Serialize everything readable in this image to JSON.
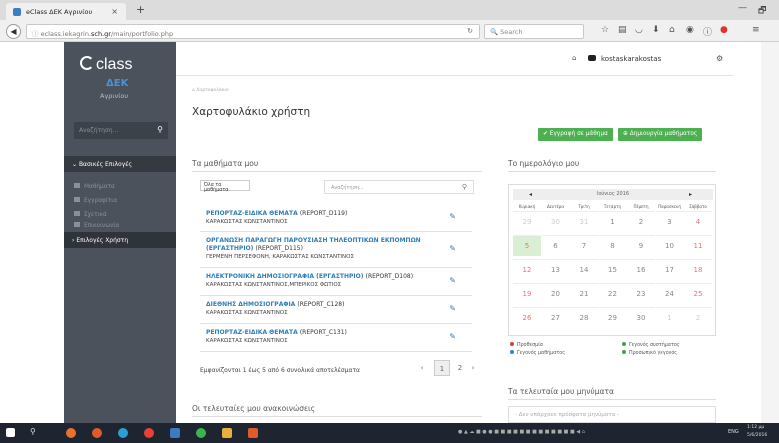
{
  "browser": {
    "tab_title": "eClass ΔΕΚ Αγρινίου",
    "tab_close": "×",
    "new_tab": "+",
    "url_prefix": "eclass.iekagrin.",
    "url_domain": "sch.gr",
    "url_path": "/main/portfolio.php",
    "search_placeholder": "Search",
    "win_min": "—",
    "win_max": "🗗"
  },
  "sidebar": {
    "logo": "class",
    "institution_short": "ΔΕΚ",
    "institution": "Αγρινίου",
    "search_placeholder": "Αναζήτηση...",
    "section_basic": "Βασικές Επιλογές",
    "items": [
      {
        "label": "Μαθήματα"
      },
      {
        "label": "Εγγραφίτια"
      },
      {
        "label": "Σχετικά"
      },
      {
        "label": "Επικοινωνία"
      }
    ],
    "section_user": "Επιλογές Χρήστη"
  },
  "topbar": {
    "username": "kostaskarakostas"
  },
  "page": {
    "breadcrumb": "Χαρτοφυλάκιο",
    "title": "Χαρτοφυλάκιο χρήστη",
    "btn_enroll": "✔ Εγγραφή σε μάθημα",
    "btn_create": "⊕ Δημιουργία μαθήματος"
  },
  "courses": {
    "heading": "Τα μαθήματα μου",
    "filter": "Όλα τα μαθήματα",
    "search_placeholder": "Αναζήτηση...",
    "items": [
      {
        "title": "ΡΕΠΟΡΤΑΖ-ΕΙΔΙΚΑ ΘΕΜΑΤΑ",
        "code": "(REPORT_D119)",
        "title2": "",
        "code2": "",
        "teachers": "ΚΑΡΑΚΩΣΤΑΣ ΚΩΝΣΤΑΝΤΙΝΟΣ"
      },
      {
        "title": "ΟΡΓΑΝΩΣΗ ΠΑΡΑΓΩΓΗ ΠΑΡΟΥΣΙΑΣΗ ΤΗΛΕΟΠΤΙΚΩΝ ΕΚΠΟΜΠΩΝ",
        "code": "",
        "title2": "(ΕΡΓΑΣΤΗΡΙΟ)",
        "code2": "(REPORT_D115)",
        "teachers": "ΓΕΡΜΕΝΗ ΠΕΡΣΕΦΟΝΗ, ΚΑΡΑΚΩΣΤΑΣ ΚΩΝΣΤΑΝΤΙΝΟΣ"
      },
      {
        "title": "ΗΛΕΚΤΡΟΝΙΚΗ ΔΗΜΟΣΙΟΓΡΑΦΙΑ (ΕΡΓΑΣΤΗΡΙΟ)",
        "code": "(REPORT_D108)",
        "title2": "",
        "code2": "",
        "teachers": "ΚΑΡΑΚΩΣΤΑΣ ΚΩΝΣΤΑΝΤΙΝΟΣ,ΜΠΕΡΙΚΟΣ ΦΩΤΙΟΣ"
      },
      {
        "title": "ΔΙΕΘΝΗΣ ΔΗΜΟΣΙΟΓΡΑΦΙΑ",
        "code": "(REPORT_C128)",
        "title2": "",
        "code2": "",
        "teachers": "ΚΑΡΑΚΩΣΤΑΣ ΚΩΝΣΤΑΝΤΙΝΟΣ"
      },
      {
        "title": "ΡΕΠΟΡΤΑΖ-ΕΙΔΙΚΑ ΘΕΜΑΤΑ",
        "code": "(REPORT_C131)",
        "title2": "",
        "code2": "",
        "teachers": "ΚΑΡΑΚΩΣΤΑΣ ΚΩΝΣΤΑΝΤΙΝΟΣ"
      }
    ],
    "results_text": "Εμφανίζονται 1 έως 5 από 6 συνολικά αποτελέσματα",
    "pag_prev": "‹",
    "pag_page1": "1",
    "pag_page2": "2",
    "pag_next": "›"
  },
  "calendar": {
    "heading": "Το ημερολόγιο μου",
    "month": "Ιούνιος 2016",
    "prev": "◂",
    "next": "▸",
    "day_names": [
      "Κυριακή",
      "Δευτέρα",
      "Τρίτη",
      "Τετάρτη",
      "Πέμπτη",
      "Παρασκευή",
      "Σάββατο"
    ],
    "weeks": [
      [
        "29",
        "30",
        "31",
        "1",
        "2",
        "3",
        "4"
      ],
      [
        "5",
        "6",
        "7",
        "8",
        "9",
        "10",
        "11"
      ],
      [
        "12",
        "13",
        "14",
        "15",
        "16",
        "17",
        "18"
      ],
      [
        "19",
        "20",
        "21",
        "22",
        "23",
        "24",
        "25"
      ],
      [
        "26",
        "27",
        "28",
        "29",
        "30",
        "1",
        "2"
      ]
    ],
    "legend": [
      {
        "label": "Προθεσμία",
        "color": "#e53935"
      },
      {
        "label": "Γεγονός συστήματος",
        "color": "#43a047"
      },
      {
        "label": "Γεγονός μαθήματος",
        "color": "#1e88e5"
      },
      {
        "label": "Προσωπικό γεγονός",
        "color": "#43a047"
      }
    ]
  },
  "messages": {
    "heading": "Τα τελευταία μου μηνύματα",
    "empty": "- Δεν υπάρχουν πρόσφατα μηνύματα -"
  },
  "announcements": {
    "heading": "Οι τελευταίες μου ανακοινώσεις"
  },
  "taskbar": {
    "lang": "ENG",
    "time": "1:12 μμ",
    "date": "5/6/2016"
  }
}
